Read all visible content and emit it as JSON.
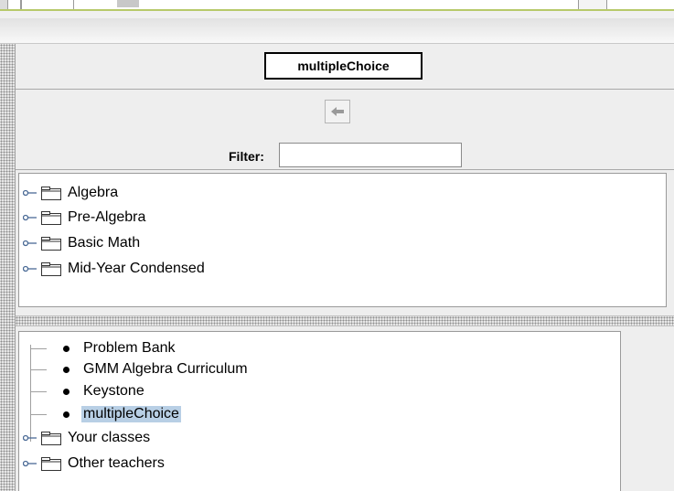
{
  "header": {
    "title": "multipleChoice"
  },
  "nav": {
    "back_icon": "back-arrow-icon",
    "filter_label": "Filter:",
    "filter_value": ""
  },
  "tree_top": {
    "items": [
      {
        "label": "Algebra",
        "icon": "folder-icon"
      },
      {
        "label": "Pre-Algebra",
        "icon": "folder-icon"
      },
      {
        "label": "Basic Math",
        "icon": "folder-icon"
      },
      {
        "label": "Mid-Year Condensed",
        "icon": "folder-icon"
      }
    ]
  },
  "tree_bottom": {
    "items": [
      {
        "label": "Problem Bank",
        "icon": "bullet-icon"
      },
      {
        "label": "GMM Algebra Curriculum",
        "icon": "bullet-icon"
      },
      {
        "label": "Keystone",
        "icon": "bullet-icon"
      },
      {
        "label": "multipleChoice",
        "icon": "bullet-icon",
        "selected": true
      },
      {
        "label": "Your classes",
        "icon": "folder-icon"
      },
      {
        "label": "Other teachers",
        "icon": "folder-icon"
      }
    ]
  },
  "colors": {
    "selection": "#b8cfe5",
    "band_green": "#b7c96a"
  }
}
